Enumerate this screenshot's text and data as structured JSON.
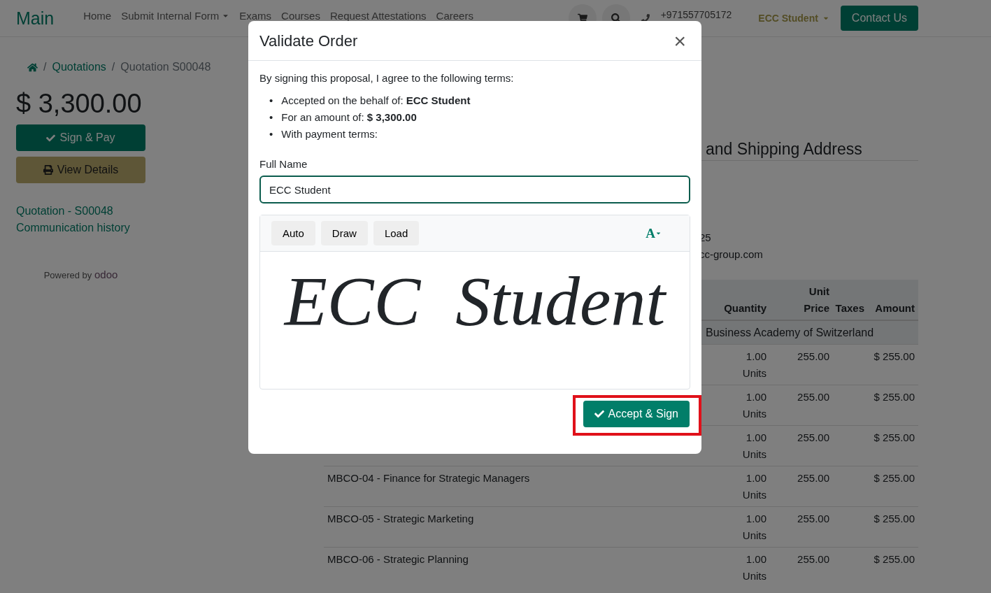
{
  "navbar": {
    "logo": "Main",
    "links": [
      {
        "label": "Home",
        "dropdown": false
      },
      {
        "label": "Submit Internal Form",
        "dropdown": true
      },
      {
        "label": "Exams",
        "dropdown": false
      },
      {
        "label": "Courses",
        "dropdown": false
      },
      {
        "label": "Request Attestations",
        "dropdown": false
      },
      {
        "label": "Careers",
        "dropdown": false
      }
    ],
    "phone": "+971557705172",
    "user": "ECC Student",
    "contact": "Contact Us"
  },
  "breadcrumb": [
    "Quotations",
    "Quotation S00048"
  ],
  "breadcrumb_separator": "/",
  "sidebar": {
    "amount": "$ 3,300.00",
    "sign_button": "Sign & Pay",
    "details_button": "View Details",
    "links": [
      "Quotation - S00048",
      "Communication history"
    ],
    "powered_by": "Powered by",
    "powered_logo": "odoo"
  },
  "address": {
    "heading": "and Shipping Address",
    "lines": [
      "25",
      "cc-group.com"
    ]
  },
  "table": {
    "columns": [
      "Quantity",
      "Unit Price",
      "Taxes",
      "Amount"
    ],
    "section": "Business Academy of Switzerland",
    "rows": [
      {
        "quantity": "1.00 Units",
        "price": "255.00",
        "amount": "$ 255.00"
      },
      {
        "quantity": "1.00 Units",
        "price": "255.00",
        "amount": "$ 255.00"
      },
      {
        "quantity": "1.00 Units",
        "price": "255.00",
        "amount": "$ 255.00"
      },
      {
        "description": "MBCO-04 - Finance for Strategic Managers",
        "quantity": "1.00 Units",
        "price": "255.00",
        "amount": "$ 255.00"
      },
      {
        "description": "MBCO-05 - Strategic Marketing",
        "quantity": "1.00 Units",
        "price": "255.00",
        "amount": "$ 255.00"
      },
      {
        "description": "MBCO-06 - Strategic Planning",
        "quantity": "1.00 Units",
        "price": "255.00",
        "amount": "$ 255.00"
      }
    ]
  },
  "modal": {
    "title": "Validate Order",
    "close": "×",
    "bullet": "•",
    "intro": "By signing this proposal, I agree to the following terms:",
    "terms": [
      "Accepted on the behalf of: **ECC Student**",
      "For an amount of: **$ 3,300.00**",
      "With payment terms:"
    ],
    "name_label": "Full Name",
    "name_value": "ECC Student",
    "modes": [
      {
        "label": "Auto",
        "selected": false
      },
      {
        "label": "Draw",
        "selected": false
      },
      {
        "label": "Load",
        "selected": false
      }
    ],
    "font_button": "A",
    "signature": "ECC  Student",
    "accept": "Accept & Sign",
    "highlighted": true
  }
}
